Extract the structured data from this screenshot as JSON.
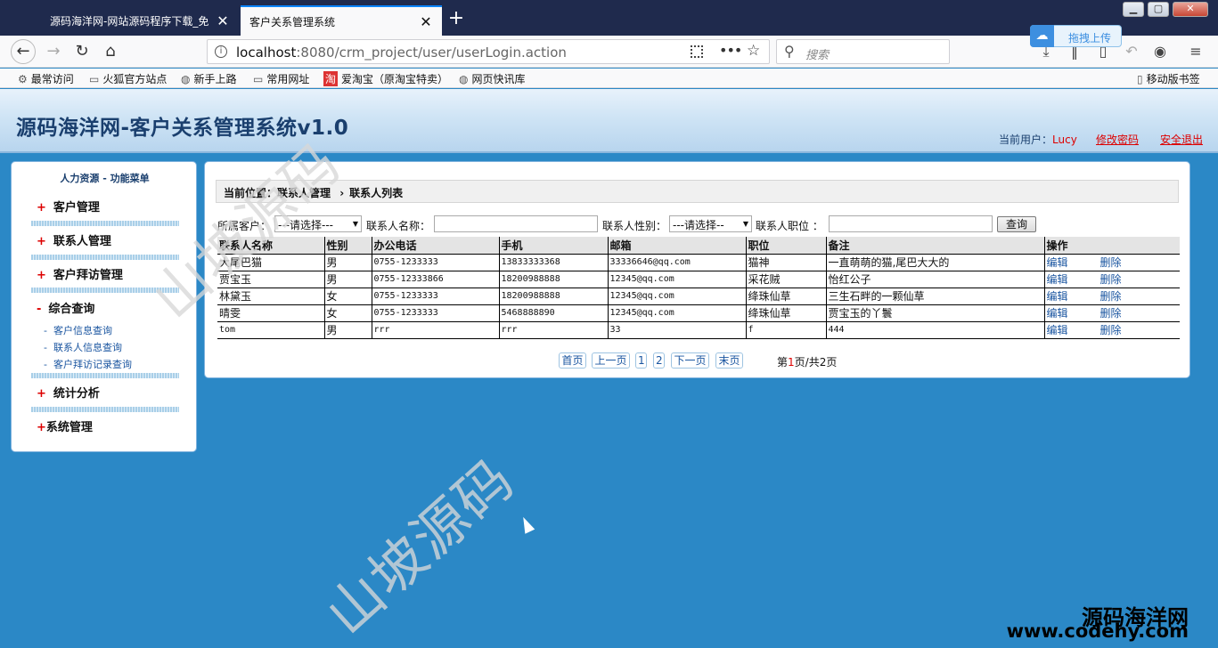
{
  "browser": {
    "tabs": [
      {
        "title": "源码海洋网-网站源码程序下载_免",
        "active": false
      },
      {
        "title": "客户关系管理系统",
        "active": true
      }
    ],
    "url_host": "localhost",
    "url_rest": ":8080/crm_project/user/userLogin.action",
    "search_placeholder": "搜索",
    "upload_label": "拖拽上传",
    "bookmarks": [
      "最常访问",
      "火狐官方站点",
      "新手上路",
      "常用网址",
      "爱淘宝（原淘宝特卖）",
      "网页快讯库"
    ],
    "mobile_bookmarks": "移动版书签"
  },
  "header": {
    "site_title": "源码海洋网-客户关系管理系统v1.0",
    "current_user_label": "当前用户：",
    "current_user": "Lucy",
    "change_password": "修改密码",
    "logout": "安全退出"
  },
  "sidebar": {
    "title": "人力资源 - 功能菜单",
    "menus": [
      {
        "mark": "+",
        "label": "客户管理"
      },
      {
        "mark": "+",
        "label": "联系人管理"
      },
      {
        "mark": "+",
        "label": "客户拜访管理"
      },
      {
        "mark": "-",
        "label": "综合查询"
      },
      {
        "mark": "+",
        "label": "统计分析"
      },
      {
        "mark": "+",
        "label": "系统管理"
      }
    ],
    "submenu": [
      "客户信息查询",
      "联系人信息查询",
      "客户拜访记录查询"
    ]
  },
  "main": {
    "crumb_label": "当前位置：",
    "crumb_section": "联系人管理",
    "crumb_page": "联系人列表",
    "filters": {
      "customer_label": "所属客户：",
      "customer_value": "---请选择---",
      "name_label": "联系人名称：",
      "name_value": "",
      "gender_label": "联系人性别：",
      "gender_value": "---请选择--",
      "position_label": "联系人职位 ：",
      "position_value": "",
      "query_button": "查询"
    },
    "columns": [
      "联系人名称",
      "性别",
      "办公电话",
      "手机",
      "邮箱",
      "职位",
      "备注",
      "操作"
    ],
    "rows": [
      {
        "name": "大尾巴猫",
        "gender": "男",
        "office": "0755-1233333",
        "mobile": "13833333368",
        "email": "33336646@qq.com",
        "position": "猫神",
        "note": "一直萌萌的猫,尾巴大大的"
      },
      {
        "name": "贾宝玉",
        "gender": "男",
        "office": "0755-12333866",
        "mobile": "18200988888",
        "email": "12345@qq.com",
        "position": "采花贼",
        "note": "怡红公子"
      },
      {
        "name": "林黛玉",
        "gender": "女",
        "office": "0755-1233333",
        "mobile": "18200988888",
        "email": "12345@qq.com",
        "position": "绛珠仙草",
        "note": "三生石畔的一颗仙草"
      },
      {
        "name": "晴雯",
        "gender": "女",
        "office": "0755-1233333",
        "mobile": "5468888890",
        "email": "12345@qq.com",
        "position": "绛珠仙草",
        "note": "贾宝玉的丫鬟"
      },
      {
        "name": "tom",
        "gender": "男",
        "office": "rrr",
        "mobile": "rrr",
        "email": "33",
        "position": "f",
        "note": "444"
      }
    ],
    "edit_label": "编辑",
    "delete_label": "删除",
    "pager": {
      "first": "首页",
      "prev": "上一页",
      "pages": [
        "1",
        "2"
      ],
      "next": "下一页",
      "last": "末页",
      "info_prefix": "第",
      "current_page": "1",
      "info_middle": "页/共",
      "total_pages": "2",
      "info_suffix": "页"
    }
  },
  "watermarks": {
    "diagonal_text": "山坡源码",
    "corner_name": "源码海洋网",
    "corner_url": "www.codehy.com"
  },
  "colors": {
    "page_background": "#2b88c6",
    "title_bar": "#1f2a4d",
    "link_red": "#dd0000",
    "link_blue": "#1a55a0"
  }
}
